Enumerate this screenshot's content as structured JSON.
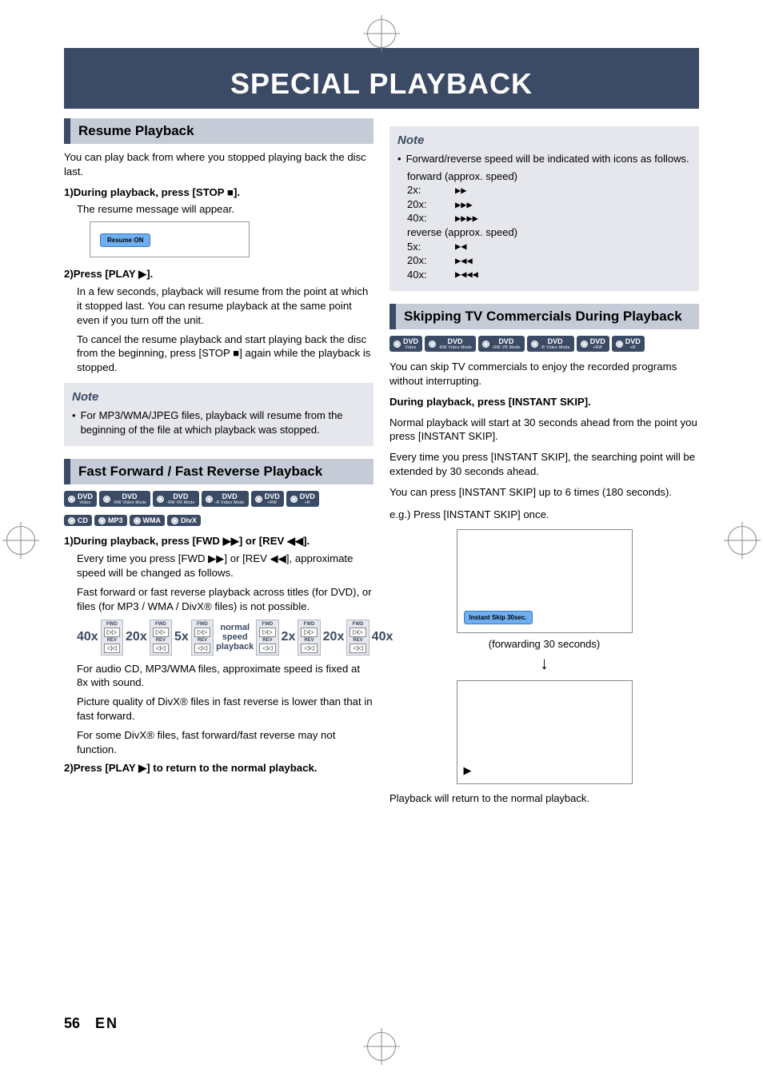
{
  "page_title": "SPECIAL PLAYBACK",
  "footer": {
    "page_num": "56",
    "lang": "EN"
  },
  "sections": {
    "resume": {
      "header": "Resume Playback",
      "intro": "You can play back from where you stopped playing back the disc last.",
      "step1_num": "1) ",
      "step1_head": "During playback, press [STOP ■].",
      "step1_body": "The resume message will appear.",
      "resume_on": "Resume ON",
      "step2_num": "2) ",
      "step2_head": "Press [PLAY ▶].",
      "step2_body": "In a few seconds, playback will resume from the point at which it stopped last. You can resume playback at the same point even if you turn off the unit.",
      "step2_cancel": "To cancel the resume playback and start playing back the disc from the beginning, press [STOP ■] again while the playback is stopped."
    },
    "resume_note": {
      "title": "Note",
      "bullet": "For MP3/WMA/JPEG files, playback will resume from the beginning of the file at which playback was stopped."
    },
    "ffrev": {
      "header": "Fast Forward / Fast Reverse Playback",
      "badges_row1": [
        "DVD Video",
        "DVD -RW Video Mode",
        "DVD -RW VR Mode",
        "DVD -R Video Mode",
        "DVD +RW",
        "DVD +R"
      ],
      "badges_row2": [
        "CD",
        "MP3",
        "WMA",
        "DivX"
      ],
      "step1_num": "1) ",
      "step1_head": "During playback, press [FWD ▶▶] or [REV ◀◀].",
      "step1_body1": "Every time you press [FWD ▶▶] or [REV ◀◀], approximate speed will be changed as follows.",
      "step1_body2": "Fast forward or fast reverse playback across titles (for DVD), or files (for MP3 / WMA / DivX® files) is not possible.",
      "speed_chain": [
        "40x",
        "20x",
        "5x",
        "normal speed playback",
        "2x",
        "20x",
        "40x"
      ],
      "after1": "For audio CD, MP3/WMA files, approximate speed is fixed at 8x with sound.",
      "after2": "Picture quality of DivX® files in fast reverse is lower than that in fast forward.",
      "after3": "For some DivX® files, fast forward/fast reverse may not function.",
      "step2_num": "2) ",
      "step2_head": "Press [PLAY ▶] to return to the normal playback."
    },
    "speed_note": {
      "title": "Note",
      "intro": "Forward/reverse speed will be indicated with icons as follows.",
      "fwd_label": "forward (approx. speed)",
      "rev_label": "reverse (approx. speed)",
      "rows_fwd": [
        {
          "label": "2x:",
          "icon": "▶▶"
        },
        {
          "label": "20x:",
          "icon": "▶▶▶"
        },
        {
          "label": "40x:",
          "icon": "▶▶▶▶"
        }
      ],
      "rows_rev": [
        {
          "label": "5x:",
          "icon": "▶◀"
        },
        {
          "label": "20x:",
          "icon": "▶◀◀"
        },
        {
          "label": "40x:",
          "icon": "▶◀◀◀"
        }
      ]
    },
    "skip": {
      "header": "Skipping TV Commercials During Playback",
      "badges": [
        "DVD Video",
        "DVD -RW Video Mode",
        "DVD -RW VR Mode",
        "DVD -R Video Mode",
        "DVD +RW",
        "DVD +R"
      ],
      "intro": "You can skip TV commercials to enjoy the recorded programs without interrupting.",
      "step_head": "During playback, press [INSTANT SKIP].",
      "body1": "Normal playback will start at 30 seconds ahead from the point you press [INSTANT SKIP].",
      "body2": "Every time you press [INSTANT SKIP], the searching point will be extended by 30 seconds ahead.",
      "body3": "You can press [INSTANT SKIP] up to 6 times (180 seconds).",
      "eg_label": "e.g.) Press [INSTANT SKIP] once.",
      "overlay": "Instant Skip 30sec.",
      "caption1": "(forwarding 30 seconds)",
      "arrow": "↓",
      "play_mark": "▶",
      "caption2": "Playback will return to the normal playback."
    }
  },
  "chart_data": {
    "type": "table",
    "title": "Fast forward / fast reverse speed indicators",
    "series": [
      {
        "name": "forward (approx. speed)",
        "rows": [
          {
            "speed": "2x",
            "icon": "▶▶"
          },
          {
            "speed": "20x",
            "icon": "▶▶▶"
          },
          {
            "speed": "40x",
            "icon": "▶▶▶▶"
          }
        ]
      },
      {
        "name": "reverse (approx. speed)",
        "rows": [
          {
            "speed": "5x",
            "icon": "▶◀"
          },
          {
            "speed": "20x",
            "icon": "▶◀◀"
          },
          {
            "speed": "40x",
            "icon": "▶◀◀◀"
          }
        ]
      }
    ],
    "speed_cycle": {
      "reverse": [
        "40x",
        "20x",
        "5x"
      ],
      "center": "normal speed playback",
      "forward": [
        "2x",
        "20x",
        "40x"
      ]
    }
  }
}
